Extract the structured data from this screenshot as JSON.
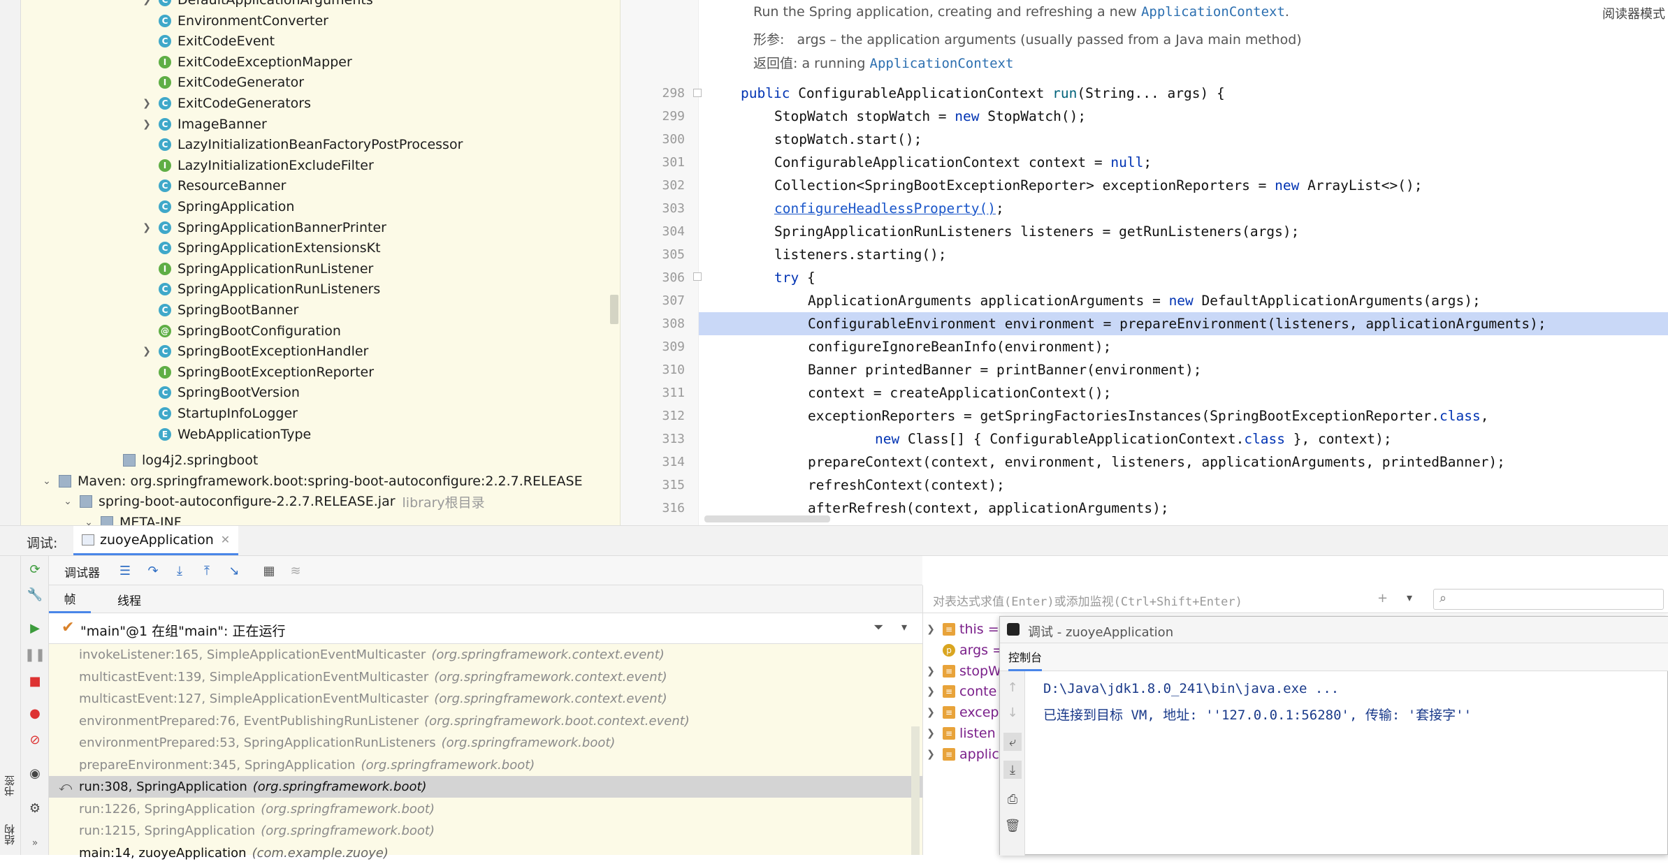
{
  "project_tree": {
    "items": [
      {
        "label": "DefaultApplicationArguments",
        "icon": "class-icon",
        "expandable": true
      },
      {
        "label": "EnvironmentConverter",
        "icon": "class-icon",
        "expandable": false
      },
      {
        "label": "ExitCodeEvent",
        "icon": "class-icon",
        "expandable": false
      },
      {
        "label": "ExitCodeExceptionMapper",
        "icon": "interface-icon",
        "expandable": false
      },
      {
        "label": "ExitCodeGenerator",
        "icon": "interface-icon",
        "expandable": false
      },
      {
        "label": "ExitCodeGenerators",
        "icon": "class-icon",
        "expandable": true
      },
      {
        "label": "ImageBanner",
        "icon": "class-icon",
        "expandable": true
      },
      {
        "label": "LazyInitializationBeanFactoryPostProcessor",
        "icon": "class-icon",
        "expandable": false
      },
      {
        "label": "LazyInitializationExcludeFilter",
        "icon": "interface-icon",
        "expandable": false
      },
      {
        "label": "ResourceBanner",
        "icon": "class-icon",
        "expandable": false
      },
      {
        "label": "SpringApplication",
        "icon": "class-icon",
        "expandable": false
      },
      {
        "label": "SpringApplicationBannerPrinter",
        "icon": "class-icon",
        "expandable": true
      },
      {
        "label": "SpringApplicationExtensionsKt",
        "icon": "class-icon",
        "expandable": false
      },
      {
        "label": "SpringApplicationRunListener",
        "icon": "interface-icon",
        "expandable": false
      },
      {
        "label": "SpringApplicationRunListeners",
        "icon": "class-icon",
        "expandable": false
      },
      {
        "label": "SpringBootBanner",
        "icon": "class-icon",
        "expandable": false
      },
      {
        "label": "SpringBootConfiguration",
        "icon": "annotation-icon",
        "expandable": false
      },
      {
        "label": "SpringBootExceptionHandler",
        "icon": "class-icon",
        "expandable": true
      },
      {
        "label": "SpringBootExceptionReporter",
        "icon": "interface-icon",
        "expandable": false
      },
      {
        "label": "SpringBootVersion",
        "icon": "class-icon",
        "expandable": false
      },
      {
        "label": "StartupInfoLogger",
        "icon": "class-icon",
        "expandable": false
      },
      {
        "label": "WebApplicationType",
        "icon": "enum-icon",
        "expandable": false
      }
    ],
    "log4j": "log4j2.springboot",
    "maven": "Maven: org.springframework.boot:spring-boot-autoconfigure:2.2.7.RELEASE",
    "jar": "spring-boot-autoconfigure-2.2.7.RELEASE.jar",
    "jar_hint": "library根目录",
    "meta_inf": "META-INF"
  },
  "editor": {
    "reader_mode": "阅读器模式",
    "doc_line1_prefix": "Run the Spring application, creating and refreshing a new ",
    "doc_line1_code": "ApplicationContext",
    "doc_line1_suffix": ".",
    "doc_param_label": "形参:",
    "doc_param_text": "args – the application arguments (usually passed from a Java main method)",
    "doc_return_label": "返回值:",
    "doc_return_text": "a running ",
    "doc_return_code": "ApplicationContext",
    "lines": [
      {
        "num": "298",
        "indent": 0,
        "html": "<span class=\"kw\">public</span> ConfigurableApplicationContext <span class=\"fn\">run</span>(String... args) {"
      },
      {
        "num": "299",
        "indent": 1,
        "html": "StopWatch stopWatch = <span class=\"kw\">new</span> StopWatch();"
      },
      {
        "num": "300",
        "indent": 1,
        "html": "stopWatch.start();"
      },
      {
        "num": "301",
        "indent": 1,
        "html": "ConfigurableApplicationContext context = <span class=\"kw\">null</span>;"
      },
      {
        "num": "302",
        "indent": 1,
        "html": "Collection&lt;SpringBootExceptionReporter&gt; exceptionReporters = <span class=\"kw\">new</span> ArrayList&lt;&gt;();"
      },
      {
        "num": "303",
        "indent": 1,
        "html": "<span class=\"lnk\">configureHeadlessProperty()</span>;"
      },
      {
        "num": "304",
        "indent": 1,
        "html": "SpringApplicationRunListeners listeners = getRunListeners(args);"
      },
      {
        "num": "305",
        "indent": 1,
        "html": "listeners.starting();"
      },
      {
        "num": "306",
        "indent": 1,
        "html": "<span class=\"kw\">try</span> {"
      },
      {
        "num": "307",
        "indent": 2,
        "html": "ApplicationArguments applicationArguments = <span class=\"kw\">new</span> DefaultApplicationArguments(args);"
      },
      {
        "num": "308",
        "indent": 2,
        "html": "ConfigurableEnvironment environment = prepareEnvironment(listeners, applicationArguments);"
      },
      {
        "num": "309",
        "indent": 2,
        "html": "configureIgnoreBeanInfo(environment);"
      },
      {
        "num": "310",
        "indent": 2,
        "html": "Banner printedBanner = printBanner(environment);"
      },
      {
        "num": "311",
        "indent": 2,
        "html": "context = createApplicationContext();"
      },
      {
        "num": "312",
        "indent": 2,
        "html": "exceptionReporters = getSpringFactoriesInstances(SpringBootExceptionReporter.<span class=\"kw\">class</span>,"
      },
      {
        "num": "313",
        "indent": 4,
        "html": "<span class=\"kw\">new</span> Class[] { ConfigurableApplicationContext.<span class=\"kw\">class</span> }, context);"
      },
      {
        "num": "314",
        "indent": 2,
        "html": "prepareContext(context, environment, listeners, applicationArguments, printedBanner);"
      },
      {
        "num": "315",
        "indent": 2,
        "html": "refreshContext(context);"
      },
      {
        "num": "316",
        "indent": 2,
        "html": "afterRefresh(context, applicationArguments);"
      }
    ]
  },
  "debug": {
    "label": "调试:",
    "session_tab": "zuoyeApplication",
    "debugger_tab": "调试器",
    "frames_tab": "帧",
    "threads_tab": "线程",
    "thread_text": "\"main\"@1 在组\"main\": 正在运行",
    "frames": [
      {
        "method": "invokeListener:165, SimpleApplicationEventMulticaster",
        "pkg": "(org.springframework.context.event)",
        "state": "lib"
      },
      {
        "method": "multicastEvent:139, SimpleApplicationEventMulticaster",
        "pkg": "(org.springframework.context.event)",
        "state": "lib"
      },
      {
        "method": "multicastEvent:127, SimpleApplicationEventMulticaster",
        "pkg": "(org.springframework.context.event)",
        "state": "lib"
      },
      {
        "method": "environmentPrepared:76, EventPublishingRunListener",
        "pkg": "(org.springframework.boot.context.event)",
        "state": "lib"
      },
      {
        "method": "environmentPrepared:53, SpringApplicationRunListeners",
        "pkg": "(org.springframework.boot)",
        "state": "lib"
      },
      {
        "method": "prepareEnvironment:345, SpringApplication",
        "pkg": "(org.springframework.boot)",
        "state": "lib"
      },
      {
        "method": "run:308, SpringApplication",
        "pkg": "(org.springframework.boot)",
        "state": "cur"
      },
      {
        "method": "run:1226, SpringApplication",
        "pkg": "(org.springframework.boot)",
        "state": "lib"
      },
      {
        "method": "run:1215, SpringApplication",
        "pkg": "(org.springframework.boot)",
        "state": "lib"
      },
      {
        "method": "main:14, zuoyeApplication",
        "pkg": "(com.example.zuoye)",
        "state": "main"
      }
    ],
    "eval_placeholder": "对表达式求值(Enter)或添加监视(Ctrl+Shift+Enter)",
    "vars": [
      "this =",
      "args =",
      "stopW",
      "conte",
      "excep",
      "listen",
      "applic"
    ],
    "popup_title": "调试 - zuoyeApplication",
    "console_tab": "控制台",
    "console_line1": "D:\\Java\\jdk1.8.0_241\\bin\\java.exe ...",
    "console_line2": "已连接到目标 VM, 地址: ''127.0.0.1:56280', 传输: '套接字''"
  },
  "side_labels": {
    "bookmarks": "书签",
    "structure": "结构"
  }
}
